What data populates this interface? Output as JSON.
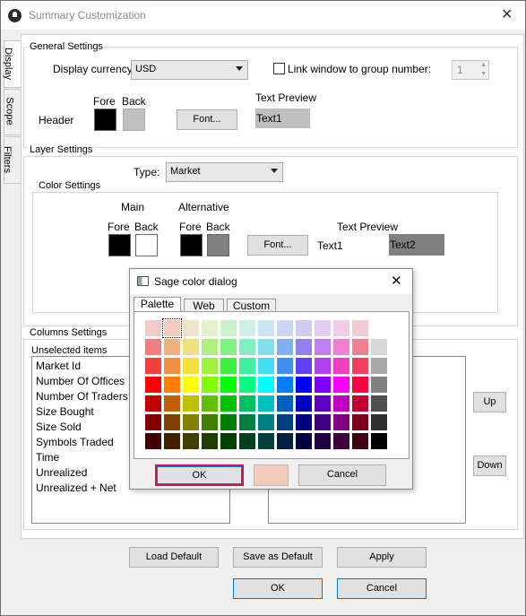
{
  "window": {
    "title": "Summary Customization"
  },
  "vtabs": [
    "Display",
    "Scope",
    "Filters"
  ],
  "general": {
    "legend": "General Settings",
    "currency_label": "Display currency:",
    "currency_value": "USD",
    "link_label": "Link window to group number:",
    "link_value": "1",
    "fore_label": "Fore",
    "back_label": "Back",
    "header_label": "Header",
    "font_button": "Font...",
    "preview_label": "Text Preview",
    "preview_text": "Text1",
    "colors": {
      "fore": "#000000",
      "back": "#c0c0c0"
    }
  },
  "layer": {
    "legend": "Layer Settings",
    "type_label": "Type:",
    "type_value": "Market",
    "color_legend": "Color Settings",
    "main_label": "Main",
    "alt_label": "Alternative",
    "fore_label": "Fore",
    "back_label": "Back",
    "font_button": "Font...",
    "preview_label": "Text Preview",
    "preview_text1": "Text1",
    "preview_text2": "Text2",
    "colors": {
      "main_fore": "#000000",
      "main_back": "#ffffff",
      "alt_fore": "#000000",
      "alt_back": "#808080"
    }
  },
  "columns": {
    "legend": "Columns Settings",
    "unselected_label": "Unselected items",
    "unselected_items": [
      "Market Id",
      "Number Of Offices",
      "Number Of Traders",
      "Size Bought",
      "Size Sold",
      "Symbols Traded",
      "Time",
      "Unrealized",
      "Unrealized + Net"
    ],
    "up_button": "Up",
    "down_button": "Down"
  },
  "footer": {
    "load_default": "Load Default",
    "save_default": "Save as Default",
    "apply": "Apply",
    "ok": "OK",
    "cancel": "Cancel"
  },
  "color_dialog": {
    "title": "Sage color dialog",
    "tabs": [
      "Palette",
      "Web",
      "Custom"
    ],
    "ok": "OK",
    "cancel": "Cancel",
    "selected_color": "#f2cbbb",
    "palette": [
      [
        "#f2cbcb",
        "#f2cbbb",
        "#f2e4cb",
        "#e4f2cb",
        "#cbf2cb",
        "#cbf2e4",
        "#cbe4f2",
        "#cbd6f2",
        "#d0cbf2",
        "#e4cbf2",
        "#f2cbe4",
        "#f2cbd6",
        "#ffffff"
      ],
      [
        "#f08080",
        "#f0b080",
        "#f0e080",
        "#b0f080",
        "#80f080",
        "#80f0c0",
        "#80e0f0",
        "#80b0f0",
        "#9080f0",
        "#c080f0",
        "#f080d0",
        "#f08090",
        "#d8d8d8"
      ],
      [
        "#f04040",
        "#f09040",
        "#f0e040",
        "#a0f040",
        "#40f040",
        "#40f0a0",
        "#40e0f0",
        "#4090f0",
        "#6040f0",
        "#b040f0",
        "#f040c0",
        "#f04060",
        "#a8a8a8"
      ],
      [
        "#ff0000",
        "#ff8000",
        "#ffff00",
        "#80ff00",
        "#00ff00",
        "#00ff80",
        "#00ffff",
        "#0080ff",
        "#0000ff",
        "#8000ff",
        "#ff00ff",
        "#ff0040",
        "#808080"
      ],
      [
        "#c00000",
        "#c06000",
        "#c0c000",
        "#60c000",
        "#00c000",
        "#00c060",
        "#00c0c0",
        "#0060c0",
        "#0000c0",
        "#6000c0",
        "#c000c0",
        "#c00030",
        "#505050"
      ],
      [
        "#800000",
        "#804000",
        "#808000",
        "#408000",
        "#008000",
        "#008040",
        "#008080",
        "#004080",
        "#000080",
        "#400080",
        "#800080",
        "#800020",
        "#303030"
      ],
      [
        "#400000",
        "#402000",
        "#404000",
        "#204000",
        "#004000",
        "#004020",
        "#004040",
        "#002040",
        "#000040",
        "#200040",
        "#400040",
        "#400010",
        "#000000"
      ]
    ]
  }
}
